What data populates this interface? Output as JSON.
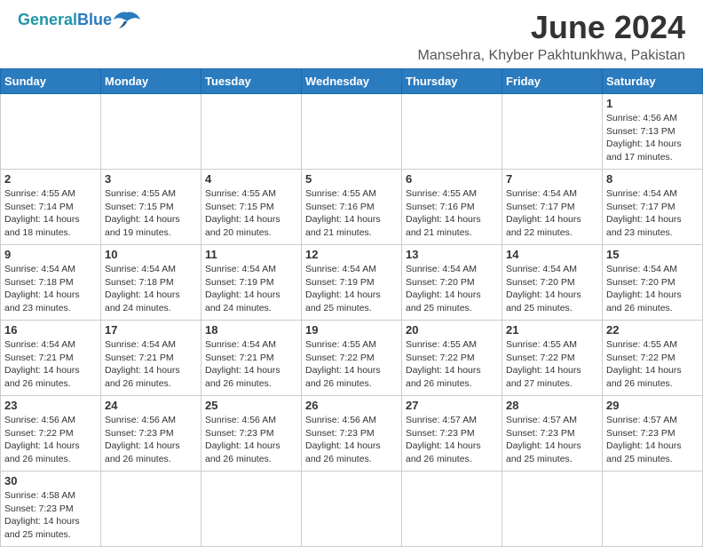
{
  "header": {
    "logo_general": "General",
    "logo_blue": "Blue",
    "month_year": "June 2024",
    "location": "Mansehra, Khyber Pakhtunkhwa, Pakistan"
  },
  "weekdays": [
    "Sunday",
    "Monday",
    "Tuesday",
    "Wednesday",
    "Thursday",
    "Friday",
    "Saturday"
  ],
  "weeks": [
    [
      {
        "day": "",
        "info": ""
      },
      {
        "day": "",
        "info": ""
      },
      {
        "day": "",
        "info": ""
      },
      {
        "day": "",
        "info": ""
      },
      {
        "day": "",
        "info": ""
      },
      {
        "day": "",
        "info": ""
      },
      {
        "day": "1",
        "info": "Sunrise: 4:56 AM\nSunset: 7:13 PM\nDaylight: 14 hours and 17 minutes."
      }
    ],
    [
      {
        "day": "2",
        "info": "Sunrise: 4:55 AM\nSunset: 7:14 PM\nDaylight: 14 hours and 18 minutes."
      },
      {
        "day": "3",
        "info": "Sunrise: 4:55 AM\nSunset: 7:15 PM\nDaylight: 14 hours and 19 minutes."
      },
      {
        "day": "4",
        "info": "Sunrise: 4:55 AM\nSunset: 7:15 PM\nDaylight: 14 hours and 20 minutes."
      },
      {
        "day": "5",
        "info": "Sunrise: 4:55 AM\nSunset: 7:16 PM\nDaylight: 14 hours and 21 minutes."
      },
      {
        "day": "6",
        "info": "Sunrise: 4:55 AM\nSunset: 7:16 PM\nDaylight: 14 hours and 21 minutes."
      },
      {
        "day": "7",
        "info": "Sunrise: 4:54 AM\nSunset: 7:17 PM\nDaylight: 14 hours and 22 minutes."
      },
      {
        "day": "8",
        "info": "Sunrise: 4:54 AM\nSunset: 7:17 PM\nDaylight: 14 hours and 23 minutes."
      }
    ],
    [
      {
        "day": "9",
        "info": "Sunrise: 4:54 AM\nSunset: 7:18 PM\nDaylight: 14 hours and 23 minutes."
      },
      {
        "day": "10",
        "info": "Sunrise: 4:54 AM\nSunset: 7:18 PM\nDaylight: 14 hours and 24 minutes."
      },
      {
        "day": "11",
        "info": "Sunrise: 4:54 AM\nSunset: 7:19 PM\nDaylight: 14 hours and 24 minutes."
      },
      {
        "day": "12",
        "info": "Sunrise: 4:54 AM\nSunset: 7:19 PM\nDaylight: 14 hours and 25 minutes."
      },
      {
        "day": "13",
        "info": "Sunrise: 4:54 AM\nSunset: 7:20 PM\nDaylight: 14 hours and 25 minutes."
      },
      {
        "day": "14",
        "info": "Sunrise: 4:54 AM\nSunset: 7:20 PM\nDaylight: 14 hours and 25 minutes."
      },
      {
        "day": "15",
        "info": "Sunrise: 4:54 AM\nSunset: 7:20 PM\nDaylight: 14 hours and 26 minutes."
      }
    ],
    [
      {
        "day": "16",
        "info": "Sunrise: 4:54 AM\nSunset: 7:21 PM\nDaylight: 14 hours and 26 minutes."
      },
      {
        "day": "17",
        "info": "Sunrise: 4:54 AM\nSunset: 7:21 PM\nDaylight: 14 hours and 26 minutes."
      },
      {
        "day": "18",
        "info": "Sunrise: 4:54 AM\nSunset: 7:21 PM\nDaylight: 14 hours and 26 minutes."
      },
      {
        "day": "19",
        "info": "Sunrise: 4:55 AM\nSunset: 7:22 PM\nDaylight: 14 hours and 26 minutes."
      },
      {
        "day": "20",
        "info": "Sunrise: 4:55 AM\nSunset: 7:22 PM\nDaylight: 14 hours and 26 minutes."
      },
      {
        "day": "21",
        "info": "Sunrise: 4:55 AM\nSunset: 7:22 PM\nDaylight: 14 hours and 27 minutes."
      },
      {
        "day": "22",
        "info": "Sunrise: 4:55 AM\nSunset: 7:22 PM\nDaylight: 14 hours and 26 minutes."
      }
    ],
    [
      {
        "day": "23",
        "info": "Sunrise: 4:56 AM\nSunset: 7:22 PM\nDaylight: 14 hours and 26 minutes."
      },
      {
        "day": "24",
        "info": "Sunrise: 4:56 AM\nSunset: 7:23 PM\nDaylight: 14 hours and 26 minutes."
      },
      {
        "day": "25",
        "info": "Sunrise: 4:56 AM\nSunset: 7:23 PM\nDaylight: 14 hours and 26 minutes."
      },
      {
        "day": "26",
        "info": "Sunrise: 4:56 AM\nSunset: 7:23 PM\nDaylight: 14 hours and 26 minutes."
      },
      {
        "day": "27",
        "info": "Sunrise: 4:57 AM\nSunset: 7:23 PM\nDaylight: 14 hours and 26 minutes."
      },
      {
        "day": "28",
        "info": "Sunrise: 4:57 AM\nSunset: 7:23 PM\nDaylight: 14 hours and 25 minutes."
      },
      {
        "day": "29",
        "info": "Sunrise: 4:57 AM\nSunset: 7:23 PM\nDaylight: 14 hours and 25 minutes."
      }
    ],
    [
      {
        "day": "30",
        "info": "Sunrise: 4:58 AM\nSunset: 7:23 PM\nDaylight: 14 hours and 25 minutes."
      },
      {
        "day": "",
        "info": ""
      },
      {
        "day": "",
        "info": ""
      },
      {
        "day": "",
        "info": ""
      },
      {
        "day": "",
        "info": ""
      },
      {
        "day": "",
        "info": ""
      },
      {
        "day": "",
        "info": ""
      }
    ]
  ]
}
